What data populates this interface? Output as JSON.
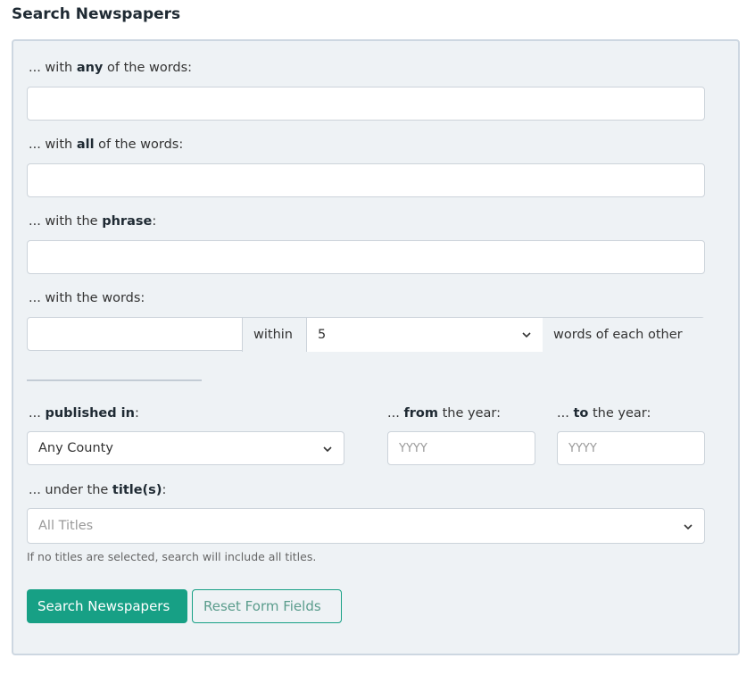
{
  "heading": "Search Newspapers",
  "any_words": {
    "prefix": "... with ",
    "bold": "any",
    "suffix": " of the words:",
    "value": ""
  },
  "all_words": {
    "prefix": "... with ",
    "bold": "all",
    "suffix": " of the words:",
    "value": ""
  },
  "phrase": {
    "prefix": "... with the ",
    "bold": "phrase",
    "suffix": ":",
    "value": ""
  },
  "proximity": {
    "label": "... with the words:",
    "value": "",
    "within": "within",
    "distance": "5",
    "suffix": "words of each other"
  },
  "published": {
    "prefix": "... ",
    "bold": "published in",
    "suffix": ":",
    "value": "Any County"
  },
  "from_year": {
    "prefix": "... ",
    "bold": "from",
    "suffix": " the year:",
    "placeholder": "YYYY"
  },
  "to_year": {
    "prefix": "... ",
    "bold": "to",
    "suffix": " the year:",
    "placeholder": "YYYY"
  },
  "titles": {
    "prefix": "... under the ",
    "bold": "title(s)",
    "suffix": ":",
    "placeholder": "All Titles",
    "help": "If no titles are selected, search will include all titles."
  },
  "buttons": {
    "search": "Search Newspapers",
    "reset": "Reset Form Fields"
  },
  "colors": {
    "accent": "#17a085",
    "panel": "#eef2f5"
  }
}
